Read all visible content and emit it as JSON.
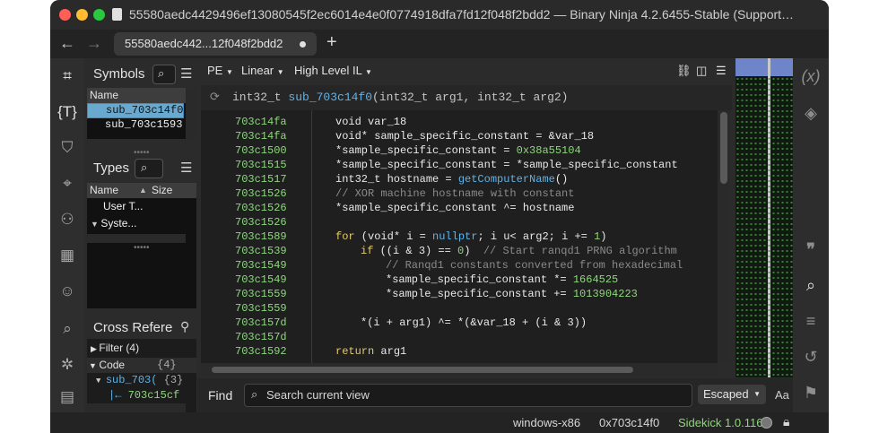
{
  "window": {
    "title": "55580aedc4429496ef13080545f2ec6014e4e0f0774918dfa7fd12f048f2bdd2 — Binary Ninja 4.2.6455-Stable (Support…"
  },
  "tabs": [
    {
      "label": "55580aedc442...12f048f2bdd2"
    }
  ],
  "symbols": {
    "title": "Symbols",
    "column": "Name",
    "items": [
      "sub_703c14f0",
      "sub_703c1593"
    ]
  },
  "types": {
    "title": "Types",
    "col_name": "Name",
    "col_size": "Size",
    "items": [
      "User T...",
      "Syste..."
    ]
  },
  "xrefs": {
    "title": "Cross Refere",
    "filter": "Filter (4)",
    "code_label": "Code",
    "code_count": "{4}",
    "sub_label": "sub_703(",
    "sub_count": "{3}",
    "ref": "703c15cf"
  },
  "toolbar": {
    "pe": "PE",
    "view": "Linear",
    "il": "High Level IL"
  },
  "function": {
    "signature_ret": "int32_t",
    "signature_name": "sub_703c14f0",
    "signature_args": "(int32_t arg1, int32_t arg2)"
  },
  "code_lines": [
    {
      "addr": "703c14fa",
      "text": "void var_18"
    },
    {
      "addr": "703c14fa",
      "text": "void* sample_specific_constant = &var_18"
    },
    {
      "addr": "703c1500",
      "pre": "*sample_specific_constant = ",
      "num": "0x38a55104"
    },
    {
      "addr": "703c1515",
      "text": "*sample_specific_constant = *sample_specific_constant"
    },
    {
      "addr": "703c1517",
      "pre": "int32_t hostname = ",
      "fn": "getComputerName",
      "post": "()"
    },
    {
      "addr": "703c1526",
      "comment": "// XOR machine hostname with constant"
    },
    {
      "addr": "703c1526",
      "text": "*sample_specific_constant ^= hostname"
    },
    {
      "addr": "703c1526",
      "text": ""
    },
    {
      "addr": "703c1589",
      "kw": "for",
      "pre": " (void* i = ",
      "fn": "nullptr",
      "post": "; i u< arg2; i += ",
      "num": "1",
      "tail": ")"
    },
    {
      "addr": "703c1539",
      "indent": 1,
      "kw": "if",
      "pre": " ((i & 3) == ",
      "num": "0",
      "tail": ")  // Start ranqd1 PRNG algorithm"
    },
    {
      "addr": "703c1549",
      "indent": 2,
      "comment": "// Ranqd1 constants converted from hexadecimal"
    },
    {
      "addr": "703c1549",
      "indent": 2,
      "pre": "*sample_specific_constant *= ",
      "num": "1664525"
    },
    {
      "addr": "703c1559",
      "indent": 2,
      "pre": "*sample_specific_constant += ",
      "num": "1013904223"
    },
    {
      "addr": "703c1559",
      "text": ""
    },
    {
      "addr": "703c157d",
      "indent": 1,
      "text": "*(i + arg1) ^= *(&var_18 + (i & 3))"
    },
    {
      "addr": "703c157d",
      "text": ""
    },
    {
      "addr": "703c1592",
      "kw": "return",
      "pre": " arg1"
    }
  ],
  "find": {
    "label": "Find",
    "placeholder": "Search current view",
    "mode": "Escaped",
    "case": "Aa"
  },
  "status": {
    "platform": "windows-x86",
    "address": "0x703c14f0",
    "sidekick": "Sidekick 1.0.116"
  },
  "colors": {
    "accent_green": "#8cd87a",
    "keyword": "#e7c96a",
    "function": "#5fb2e8",
    "selection": "#6aa9cf"
  }
}
